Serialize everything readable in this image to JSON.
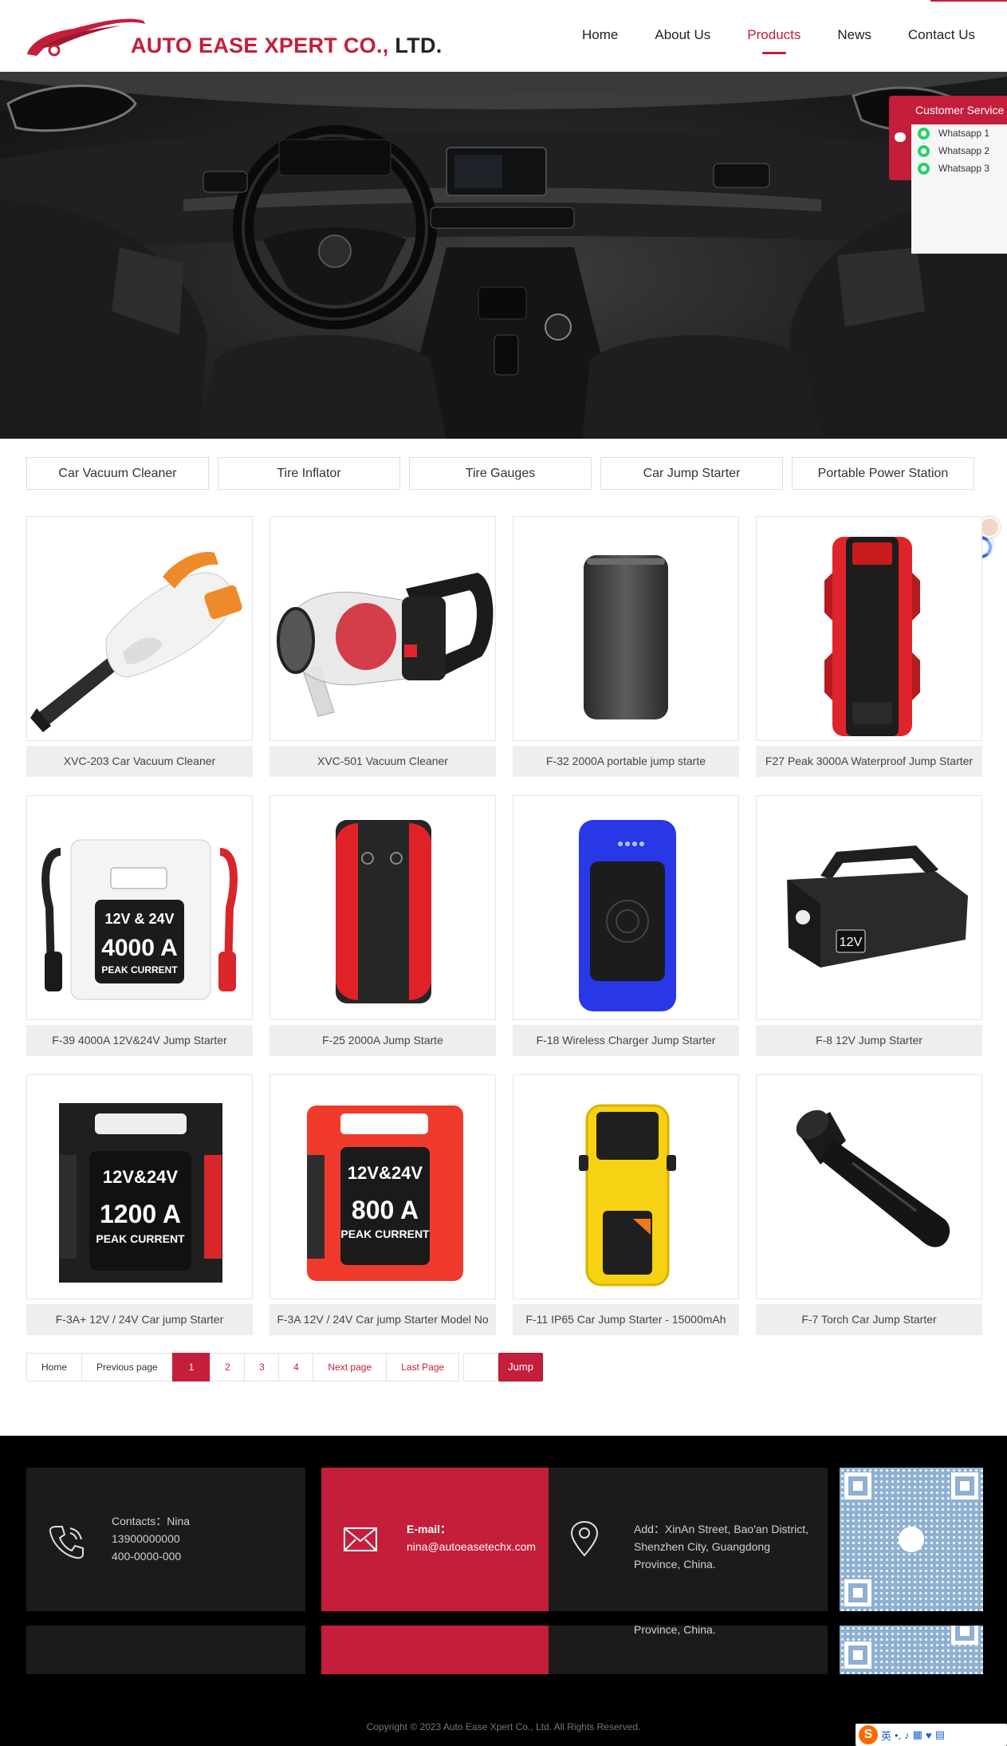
{
  "header": {
    "logo_text": "AUTO EASE XPERT CO.,",
    "logo_suffix": "LTD.",
    "nav": [
      {
        "label": "Home",
        "active": false
      },
      {
        "label": "About Us",
        "active": false
      },
      {
        "label": "Products",
        "active": true
      },
      {
        "label": "News",
        "active": false
      },
      {
        "label": "Contact Us",
        "active": false
      }
    ]
  },
  "customer_service": {
    "title": "Customer Service",
    "items": [
      "Whatsapp 1",
      "Whatsapp 2",
      "Whatsapp 3"
    ]
  },
  "categories": [
    "Car Vacuum Cleaner",
    "Tire Inflator",
    "Tire Gauges",
    "Car Jump Starter",
    "Portable Power Station"
  ],
  "products": [
    {
      "name": "XVC-203 Car Vacuum Cleaner",
      "icon": "handheld-vacuum-orange"
    },
    {
      "name": "XVC-501 Vacuum Cleaner",
      "icon": "handheld-vacuum-red"
    },
    {
      "name": "F-32 2000A portable jump starte",
      "icon": "jump-starter-slim"
    },
    {
      "name": "F27 Peak 3000A Waterproof Jump Starter",
      "icon": "jump-starter-rugged"
    },
    {
      "name": "F-39 4000A 12V&24V Jump Starter",
      "icon": "jump-starter-white"
    },
    {
      "name": "F-25 2000A Jump Starte",
      "icon": "jump-starter-black-red"
    },
    {
      "name": "F-18 Wireless Charger Jump Starter",
      "icon": "jump-starter-blue"
    },
    {
      "name": "F-8 12V Jump Starter",
      "icon": "jump-starter-handle"
    },
    {
      "name": "F-3A+ 12V / 24V Car jump Starter",
      "icon": "jump-starter-black-case"
    },
    {
      "name": "F-3A 12V / 24V Car jump Starter Model No",
      "icon": "jump-starter-red-case"
    },
    {
      "name": "F-11 IP65 Car Jump Starter - 15000mAh",
      "icon": "jump-starter-yellow"
    },
    {
      "name": "F-7 Torch Car Jump Starter",
      "icon": "flashlight"
    }
  ],
  "product_labels": {
    "p5_line1": "12V & 24V",
    "p5_line2": "4000 A",
    "p5_line3": "PEAK CURRENT",
    "p8_badge": "12V",
    "p9_line1": "12V&24V",
    "p9_line2": "1200 A",
    "p9_line3": "PEAK CURRENT",
    "p10_line1": "12V&24V",
    "p10_line2": "800 A",
    "p10_line3": "PEAK CURRENT"
  },
  "pagination": {
    "home": "Home",
    "prev": "Previous page",
    "pages": [
      "1",
      "2",
      "3",
      "4"
    ],
    "current": "1",
    "next": "Next page",
    "last": "Last Page",
    "jump": "Jump"
  },
  "footer": {
    "contacts_line1": "Contacts：Nina",
    "contacts_line2": "13900000000",
    "contacts_line3": "400-0000-000",
    "email_label": "E-mail：",
    "email_value": "nina@autoeasetechx.com",
    "address": "Add：XinAn Street, Bao'an District, Shenzhen City, Guangdong Province, China.",
    "address_overflow": "Province, China.",
    "copyright": "Copyright © 2023 Auto Ease Xpert Co., Ltd. All Rights Reserved."
  },
  "ime_toolbar": {
    "label": "英"
  },
  "colors": {
    "accent": "#c41e3a",
    "footer_bg": "#000000",
    "footer_box": "#1b1b1b"
  }
}
